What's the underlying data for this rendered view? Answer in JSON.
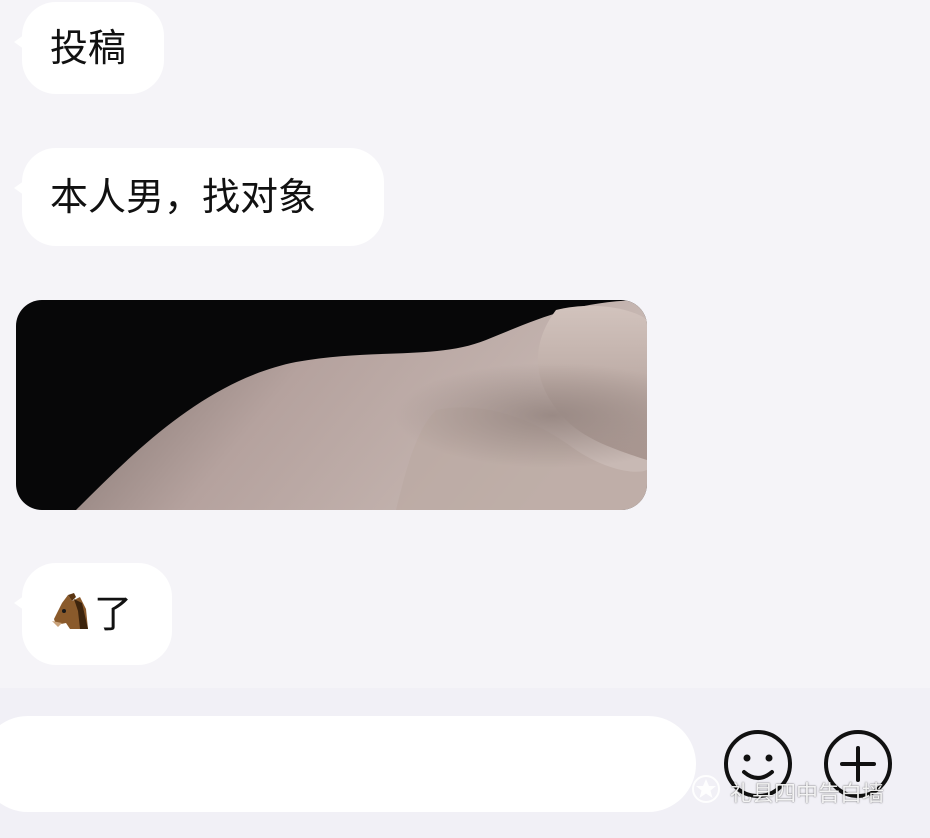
{
  "messages": [
    {
      "type": "text",
      "text": "投稿"
    },
    {
      "type": "text",
      "text": "本人男，找对象"
    },
    {
      "type": "image"
    },
    {
      "type": "text",
      "emoji": "horse-face",
      "text": "了"
    }
  ],
  "input_bar": {
    "emoji_button_icon": "smiley-icon",
    "more_button_icon": "plus-icon"
  },
  "watermark": {
    "icon": "star-ring-icon",
    "text": "礼县四中告白墙"
  },
  "colors": {
    "background": "#f5f4f8",
    "bubble": "#ffffff",
    "text": "#111111"
  }
}
